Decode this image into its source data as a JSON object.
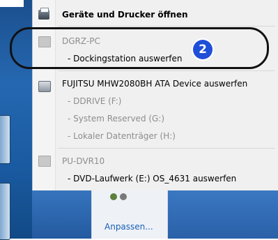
{
  "menu": {
    "open_devices": "Geräte und Drucker öffnen",
    "dgrz_pc": "DGRZ-PC",
    "eject_dock": "- Dockingstation auswerfen",
    "fujitsu_eject": "FUJITSU MHW2080BH ATA Device auswerfen",
    "ddrive": "- DDRIVE (F:)",
    "system_reserved": "- System Reserved (G:)",
    "local_disk": "- Lokaler Datenträger (H:)",
    "pu_dvr": "PU-DVR10",
    "dvd_eject": "- DVD-Laufwerk (E:) OS_4631 auswerfen"
  },
  "annotation": {
    "badge": "2"
  },
  "tray": {
    "customize": "Anpassen..."
  },
  "colors": {
    "badge": "#1f4fd8",
    "link": "#1a5fb4"
  }
}
